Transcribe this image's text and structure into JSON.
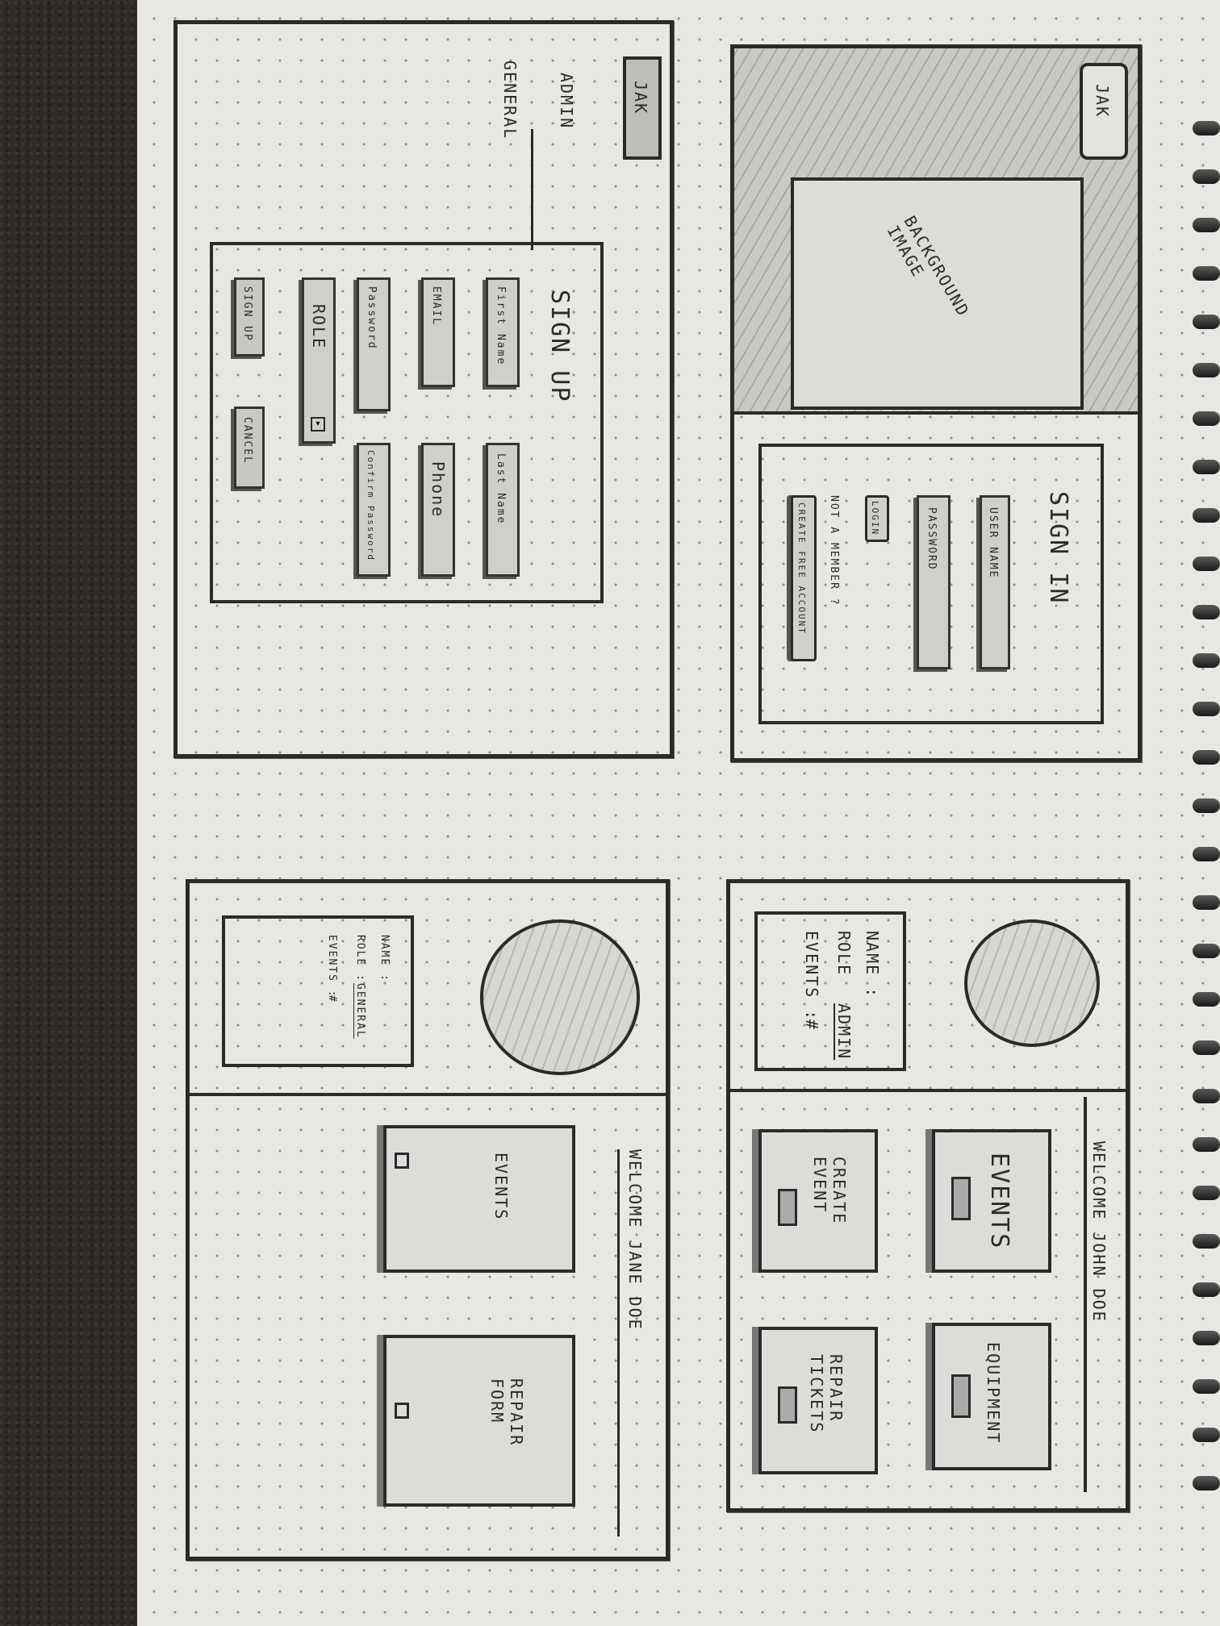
{
  "signin": {
    "logo": "JAK",
    "bg_label": "BACKGROUND IMAGE",
    "title": "SIGN IN",
    "username_placeholder": "USER NAME",
    "password_placeholder": "PASSWORD",
    "login_label": "LOGIN",
    "not_member": "NOT A MEMBER ?",
    "create_account": "CREATE FREE ACCOUNT"
  },
  "signup": {
    "logo": "JAK",
    "title": "SIGN UP",
    "first_name": "First Name",
    "last_name": "Last Name",
    "email": "EMAIL",
    "phone": "Phone",
    "password": "Password",
    "confirm_password": "Confirm Password",
    "role": "ROLE",
    "role_options": [
      "ADMIN",
      "GENERAL"
    ],
    "signup_btn": "SIGN UP",
    "cancel_btn": "CANCEL"
  },
  "admin_dash": {
    "name_label": "NAME :",
    "role_label": "ROLE",
    "role_value": "ADMIN",
    "events_label": "EVENTS :",
    "events_value": "#",
    "welcome": "WELCOME JOHN DOE",
    "cards": [
      "EVENTS",
      "EQUIPMENT",
      "CREATE EVENT",
      "REPAIR TICKETS"
    ]
  },
  "general_dash": {
    "name_label": "NAME :",
    "role_label": "ROLE :",
    "role_value": "GENERAL",
    "events_label": "EVENTS :",
    "events_value": "#",
    "welcome": "WELCOME JANE DOE",
    "cards": [
      "EVENTS",
      "REPAIR FORM"
    ]
  }
}
